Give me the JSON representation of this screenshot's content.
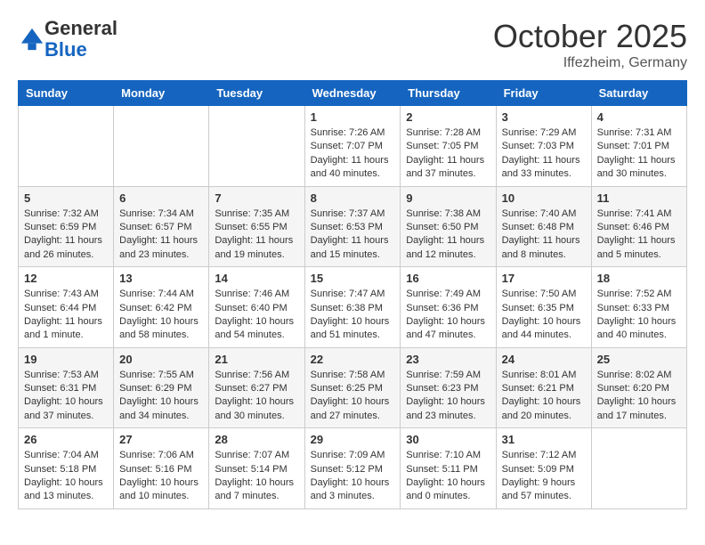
{
  "header": {
    "logo_line1": "General",
    "logo_line2": "Blue",
    "month_title": "October 2025",
    "location": "Iffezheim, Germany"
  },
  "weekdays": [
    "Sunday",
    "Monday",
    "Tuesday",
    "Wednesday",
    "Thursday",
    "Friday",
    "Saturday"
  ],
  "weeks": [
    [
      {
        "day": "",
        "sunrise": "",
        "sunset": "",
        "daylight": "",
        "empty": true
      },
      {
        "day": "",
        "sunrise": "",
        "sunset": "",
        "daylight": "",
        "empty": true
      },
      {
        "day": "",
        "sunrise": "",
        "sunset": "",
        "daylight": "",
        "empty": true
      },
      {
        "day": "1",
        "sunrise": "Sunrise: 7:26 AM",
        "sunset": "Sunset: 7:07 PM",
        "daylight": "Daylight: 11 hours and 40 minutes."
      },
      {
        "day": "2",
        "sunrise": "Sunrise: 7:28 AM",
        "sunset": "Sunset: 7:05 PM",
        "daylight": "Daylight: 11 hours and 37 minutes."
      },
      {
        "day": "3",
        "sunrise": "Sunrise: 7:29 AM",
        "sunset": "Sunset: 7:03 PM",
        "daylight": "Daylight: 11 hours and 33 minutes."
      },
      {
        "day": "4",
        "sunrise": "Sunrise: 7:31 AM",
        "sunset": "Sunset: 7:01 PM",
        "daylight": "Daylight: 11 hours and 30 minutes."
      }
    ],
    [
      {
        "day": "5",
        "sunrise": "Sunrise: 7:32 AM",
        "sunset": "Sunset: 6:59 PM",
        "daylight": "Daylight: 11 hours and 26 minutes."
      },
      {
        "day": "6",
        "sunrise": "Sunrise: 7:34 AM",
        "sunset": "Sunset: 6:57 PM",
        "daylight": "Daylight: 11 hours and 23 minutes."
      },
      {
        "day": "7",
        "sunrise": "Sunrise: 7:35 AM",
        "sunset": "Sunset: 6:55 PM",
        "daylight": "Daylight: 11 hours and 19 minutes."
      },
      {
        "day": "8",
        "sunrise": "Sunrise: 7:37 AM",
        "sunset": "Sunset: 6:53 PM",
        "daylight": "Daylight: 11 hours and 15 minutes."
      },
      {
        "day": "9",
        "sunrise": "Sunrise: 7:38 AM",
        "sunset": "Sunset: 6:50 PM",
        "daylight": "Daylight: 11 hours and 12 minutes."
      },
      {
        "day": "10",
        "sunrise": "Sunrise: 7:40 AM",
        "sunset": "Sunset: 6:48 PM",
        "daylight": "Daylight: 11 hours and 8 minutes."
      },
      {
        "day": "11",
        "sunrise": "Sunrise: 7:41 AM",
        "sunset": "Sunset: 6:46 PM",
        "daylight": "Daylight: 11 hours and 5 minutes."
      }
    ],
    [
      {
        "day": "12",
        "sunrise": "Sunrise: 7:43 AM",
        "sunset": "Sunset: 6:44 PM",
        "daylight": "Daylight: 11 hours and 1 minute."
      },
      {
        "day": "13",
        "sunrise": "Sunrise: 7:44 AM",
        "sunset": "Sunset: 6:42 PM",
        "daylight": "Daylight: 10 hours and 58 minutes."
      },
      {
        "day": "14",
        "sunrise": "Sunrise: 7:46 AM",
        "sunset": "Sunset: 6:40 PM",
        "daylight": "Daylight: 10 hours and 54 minutes."
      },
      {
        "day": "15",
        "sunrise": "Sunrise: 7:47 AM",
        "sunset": "Sunset: 6:38 PM",
        "daylight": "Daylight: 10 hours and 51 minutes."
      },
      {
        "day": "16",
        "sunrise": "Sunrise: 7:49 AM",
        "sunset": "Sunset: 6:36 PM",
        "daylight": "Daylight: 10 hours and 47 minutes."
      },
      {
        "day": "17",
        "sunrise": "Sunrise: 7:50 AM",
        "sunset": "Sunset: 6:35 PM",
        "daylight": "Daylight: 10 hours and 44 minutes."
      },
      {
        "day": "18",
        "sunrise": "Sunrise: 7:52 AM",
        "sunset": "Sunset: 6:33 PM",
        "daylight": "Daylight: 10 hours and 40 minutes."
      }
    ],
    [
      {
        "day": "19",
        "sunrise": "Sunrise: 7:53 AM",
        "sunset": "Sunset: 6:31 PM",
        "daylight": "Daylight: 10 hours and 37 minutes."
      },
      {
        "day": "20",
        "sunrise": "Sunrise: 7:55 AM",
        "sunset": "Sunset: 6:29 PM",
        "daylight": "Daylight: 10 hours and 34 minutes."
      },
      {
        "day": "21",
        "sunrise": "Sunrise: 7:56 AM",
        "sunset": "Sunset: 6:27 PM",
        "daylight": "Daylight: 10 hours and 30 minutes."
      },
      {
        "day": "22",
        "sunrise": "Sunrise: 7:58 AM",
        "sunset": "Sunset: 6:25 PM",
        "daylight": "Daylight: 10 hours and 27 minutes."
      },
      {
        "day": "23",
        "sunrise": "Sunrise: 7:59 AM",
        "sunset": "Sunset: 6:23 PM",
        "daylight": "Daylight: 10 hours and 23 minutes."
      },
      {
        "day": "24",
        "sunrise": "Sunrise: 8:01 AM",
        "sunset": "Sunset: 6:21 PM",
        "daylight": "Daylight: 10 hours and 20 minutes."
      },
      {
        "day": "25",
        "sunrise": "Sunrise: 8:02 AM",
        "sunset": "Sunset: 6:20 PM",
        "daylight": "Daylight: 10 hours and 17 minutes."
      }
    ],
    [
      {
        "day": "26",
        "sunrise": "Sunrise: 7:04 AM",
        "sunset": "Sunset: 5:18 PM",
        "daylight": "Daylight: 10 hours and 13 minutes."
      },
      {
        "day": "27",
        "sunrise": "Sunrise: 7:06 AM",
        "sunset": "Sunset: 5:16 PM",
        "daylight": "Daylight: 10 hours and 10 minutes."
      },
      {
        "day": "28",
        "sunrise": "Sunrise: 7:07 AM",
        "sunset": "Sunset: 5:14 PM",
        "daylight": "Daylight: 10 hours and 7 minutes."
      },
      {
        "day": "29",
        "sunrise": "Sunrise: 7:09 AM",
        "sunset": "Sunset: 5:12 PM",
        "daylight": "Daylight: 10 hours and 3 minutes."
      },
      {
        "day": "30",
        "sunrise": "Sunrise: 7:10 AM",
        "sunset": "Sunset: 5:11 PM",
        "daylight": "Daylight: 10 hours and 0 minutes."
      },
      {
        "day": "31",
        "sunrise": "Sunrise: 7:12 AM",
        "sunset": "Sunset: 5:09 PM",
        "daylight": "Daylight: 9 hours and 57 minutes."
      },
      {
        "day": "",
        "sunrise": "",
        "sunset": "",
        "daylight": "",
        "empty": true
      }
    ]
  ]
}
